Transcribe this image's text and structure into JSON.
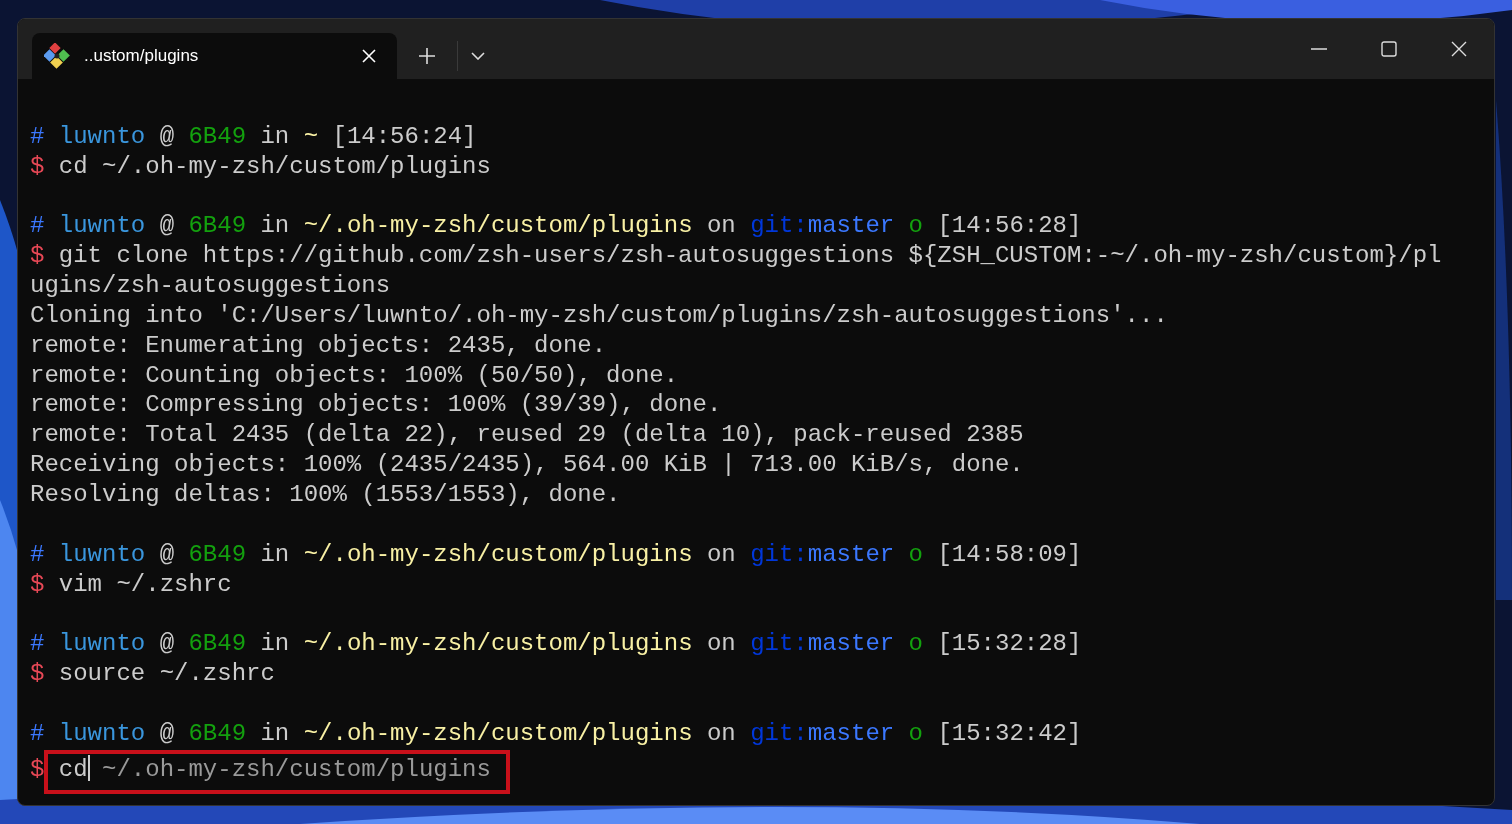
{
  "tabs": [
    {
      "title": "..ustom/plugins",
      "selected": true
    }
  ],
  "terminal": {
    "lines": [
      {
        "kind": "blank"
      },
      {
        "kind": "text",
        "segments": [
          {
            "text": "# ",
            "kind": "hash"
          },
          {
            "text": "luwnto",
            "kind": "user"
          },
          {
            "text": " @ ",
            "kind": "plain"
          },
          {
            "text": "6B49",
            "kind": "host"
          },
          {
            "text": " in ",
            "kind": "plain"
          },
          {
            "text": "~",
            "kind": "path"
          },
          {
            "text": " [14:56:24]",
            "kind": "plain"
          }
        ]
      },
      {
        "kind": "text",
        "segments": [
          {
            "text": "$ ",
            "kind": "dollar"
          },
          {
            "text": "cd ~/.oh-my-zsh/custom/plugins",
            "kind": "plain"
          }
        ]
      },
      {
        "kind": "blank"
      },
      {
        "kind": "text",
        "segments": [
          {
            "text": "# ",
            "kind": "hash"
          },
          {
            "text": "luwnto",
            "kind": "user"
          },
          {
            "text": " @ ",
            "kind": "plain"
          },
          {
            "text": "6B49",
            "kind": "host"
          },
          {
            "text": " in ",
            "kind": "plain"
          },
          {
            "text": "~/.oh-my-zsh/custom/plugins",
            "kind": "path"
          },
          {
            "text": " on ",
            "kind": "plain"
          },
          {
            "text": "git:",
            "kind": "git"
          },
          {
            "text": "master",
            "kind": "branch"
          },
          {
            "text": " o",
            "kind": "clean"
          },
          {
            "text": " [14:56:28]",
            "kind": "plain"
          }
        ]
      },
      {
        "kind": "text",
        "segments": [
          {
            "text": "$ ",
            "kind": "dollar"
          },
          {
            "text": "git clone https://github.com/zsh-users/zsh-autosuggestions ${ZSH_CUSTOM:-~/.oh-my-zsh/custom}/pl",
            "kind": "plain"
          }
        ]
      },
      {
        "kind": "text",
        "segments": [
          {
            "text": "ugins/zsh-autosuggestions",
            "kind": "plain"
          }
        ]
      },
      {
        "kind": "text",
        "segments": [
          {
            "text": "Cloning into 'C:/Users/luwnto/.oh-my-zsh/custom/plugins/zsh-autosuggestions'...",
            "kind": "plain"
          }
        ]
      },
      {
        "kind": "text",
        "segments": [
          {
            "text": "remote: Enumerating objects: 2435, done.",
            "kind": "plain"
          }
        ]
      },
      {
        "kind": "text",
        "segments": [
          {
            "text": "remote: Counting objects: 100% (50/50), done.",
            "kind": "plain"
          }
        ]
      },
      {
        "kind": "text",
        "segments": [
          {
            "text": "remote: Compressing objects: 100% (39/39), done.",
            "kind": "plain"
          }
        ]
      },
      {
        "kind": "text",
        "segments": [
          {
            "text": "remote: Total 2435 (delta 22), reused 29 (delta 10), pack-reused 2385",
            "kind": "plain"
          }
        ]
      },
      {
        "kind": "text",
        "segments": [
          {
            "text": "Receiving objects: 100% (2435/2435), 564.00 KiB | 713.00 KiB/s, done.",
            "kind": "plain"
          }
        ]
      },
      {
        "kind": "text",
        "segments": [
          {
            "text": "Resolving deltas: 100% (1553/1553), done.",
            "kind": "plain"
          }
        ]
      },
      {
        "kind": "blank"
      },
      {
        "kind": "text",
        "segments": [
          {
            "text": "# ",
            "kind": "hash"
          },
          {
            "text": "luwnto",
            "kind": "user"
          },
          {
            "text": " @ ",
            "kind": "plain"
          },
          {
            "text": "6B49",
            "kind": "host"
          },
          {
            "text": " in ",
            "kind": "plain"
          },
          {
            "text": "~/.oh-my-zsh/custom/plugins",
            "kind": "path"
          },
          {
            "text": " on ",
            "kind": "plain"
          },
          {
            "text": "git:",
            "kind": "git"
          },
          {
            "text": "master",
            "kind": "branch"
          },
          {
            "text": " o",
            "kind": "clean"
          },
          {
            "text": " [14:58:09]",
            "kind": "plain"
          }
        ]
      },
      {
        "kind": "text",
        "segments": [
          {
            "text": "$ ",
            "kind": "dollar"
          },
          {
            "text": "vim ~/.zshrc",
            "kind": "plain"
          }
        ]
      },
      {
        "kind": "blank"
      },
      {
        "kind": "text",
        "segments": [
          {
            "text": "# ",
            "kind": "hash"
          },
          {
            "text": "luwnto",
            "kind": "user"
          },
          {
            "text": " @ ",
            "kind": "plain"
          },
          {
            "text": "6B49",
            "kind": "host"
          },
          {
            "text": " in ",
            "kind": "plain"
          },
          {
            "text": "~/.oh-my-zsh/custom/plugins",
            "kind": "path"
          },
          {
            "text": " on ",
            "kind": "plain"
          },
          {
            "text": "git:",
            "kind": "git"
          },
          {
            "text": "master",
            "kind": "branch"
          },
          {
            "text": " o",
            "kind": "clean"
          },
          {
            "text": " [15:32:28]",
            "kind": "plain"
          }
        ]
      },
      {
        "kind": "text",
        "segments": [
          {
            "text": "$ ",
            "kind": "dollar"
          },
          {
            "text": "source ~/.zshrc",
            "kind": "plain"
          }
        ]
      },
      {
        "kind": "blank"
      },
      {
        "kind": "text",
        "segments": [
          {
            "text": "# ",
            "kind": "hash"
          },
          {
            "text": "luwnto",
            "kind": "user"
          },
          {
            "text": " @ ",
            "kind": "plain"
          },
          {
            "text": "6B49",
            "kind": "host"
          },
          {
            "text": " in ",
            "kind": "plain"
          },
          {
            "text": "~/.oh-my-zsh/custom/plugins",
            "kind": "path"
          },
          {
            "text": " on ",
            "kind": "plain"
          },
          {
            "text": "git:",
            "kind": "git"
          },
          {
            "text": "master",
            "kind": "branch"
          },
          {
            "text": " o",
            "kind": "clean"
          },
          {
            "text": " [15:32:42]",
            "kind": "plain"
          }
        ]
      },
      {
        "kind": "text",
        "highlighted": true,
        "segments": [
          {
            "text": "$ ",
            "kind": "dollar"
          },
          {
            "text": "cd",
            "kind": "plain",
            "cursor": true
          },
          {
            "text": " ~/.oh-my-zsh/custom/plugins",
            "kind": "suggestion"
          }
        ]
      }
    ]
  }
}
